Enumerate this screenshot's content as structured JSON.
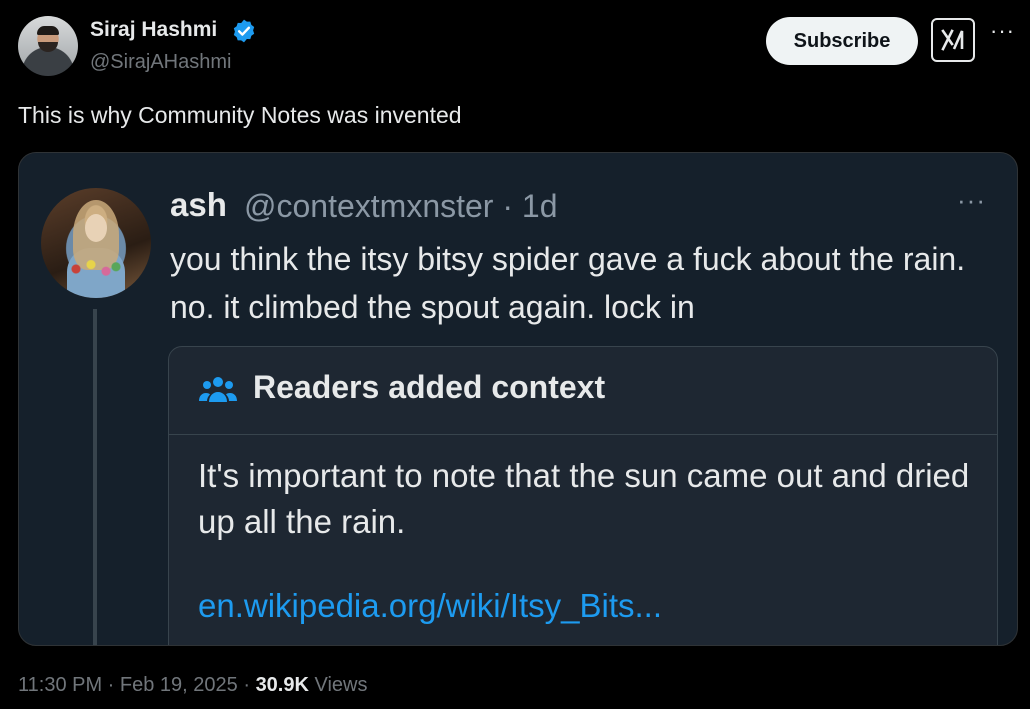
{
  "author": {
    "name": "Siraj Hashmi",
    "handle": "@SirajAHashmi"
  },
  "actions": {
    "subscribe_label": "Subscribe",
    "grok_icon": "grok-icon",
    "more_icon": "more-icon"
  },
  "tweet": {
    "text": "This is why Community Notes was invented"
  },
  "quoted": {
    "name": "ash",
    "handle_time": "@contextmxnster · 1d",
    "text": "you think the itsy bitsy spider gave a fuck about the rain. no. it climbed the spout again. lock in",
    "note": {
      "title": "Readers added context",
      "body": "It's important to note that the sun came out and dried up all the rain.",
      "link": "en.wikipedia.org/wiki/Itsy_Bits..."
    }
  },
  "footer": {
    "time": "11:30 PM",
    "date": "Feb 19, 2025",
    "views_count": "30.9K",
    "views_label": "Views"
  },
  "colors": {
    "background": "#000000",
    "card": "#15202b",
    "link": "#1d9bf0",
    "verified": "#1d9bf0"
  }
}
